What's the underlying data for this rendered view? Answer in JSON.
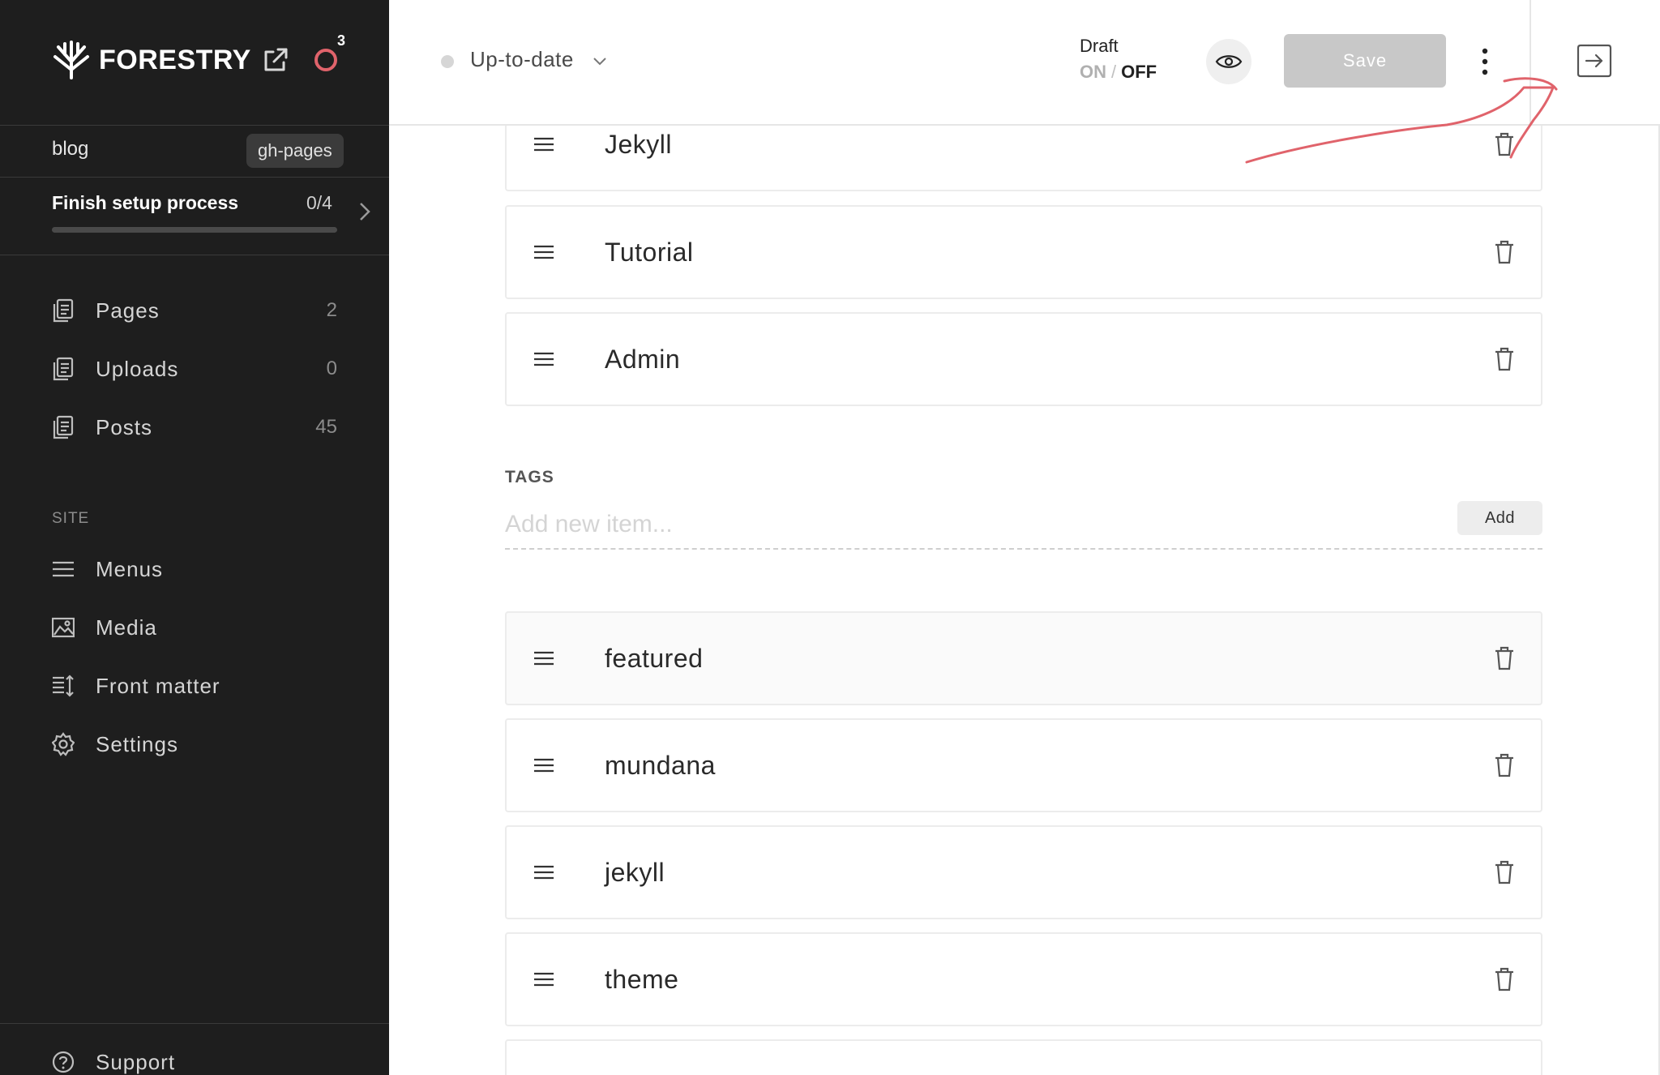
{
  "app": {
    "name": "FORESTRY",
    "notifications": "3"
  },
  "site": {
    "name": "blog",
    "branch": "gh-pages"
  },
  "setup": {
    "title": "Finish setup process",
    "progress": "0/4",
    "progress_fraction": 0
  },
  "nav": [
    {
      "label": "Pages",
      "count": "2",
      "icon": "document-icon"
    },
    {
      "label": "Uploads",
      "count": "0",
      "icon": "document-icon"
    },
    {
      "label": "Posts",
      "count": "45",
      "icon": "document-icon"
    }
  ],
  "site_section": {
    "label": "SITE",
    "items": [
      {
        "label": "Menus",
        "icon": "menu-icon"
      },
      {
        "label": "Media",
        "icon": "image-icon"
      },
      {
        "label": "Front matter",
        "icon": "front-matter-icon"
      },
      {
        "label": "Settings",
        "icon": "gear-icon"
      }
    ]
  },
  "support": {
    "label": "Support",
    "icon": "help-icon"
  },
  "topbar": {
    "status": "Up-to-date",
    "draft_label": "Draft",
    "draft_on": "ON",
    "draft_sep": "/",
    "draft_off": "OFF",
    "draft_state": "off",
    "save_label": "Save"
  },
  "categories": {
    "items": [
      "Jekyll",
      "Tutorial",
      "Admin"
    ]
  },
  "tags": {
    "heading": "TAGS",
    "placeholder": "Add new item...",
    "add_label": "Add",
    "items": [
      "featured",
      "mundana",
      "jekyll",
      "theme"
    ]
  },
  "colors": {
    "sidebar_bg": "#1e1e1e",
    "accent": "#e0636b",
    "save_disabled": "#c8c8c8",
    "annotation_stroke": "#e0636b"
  }
}
